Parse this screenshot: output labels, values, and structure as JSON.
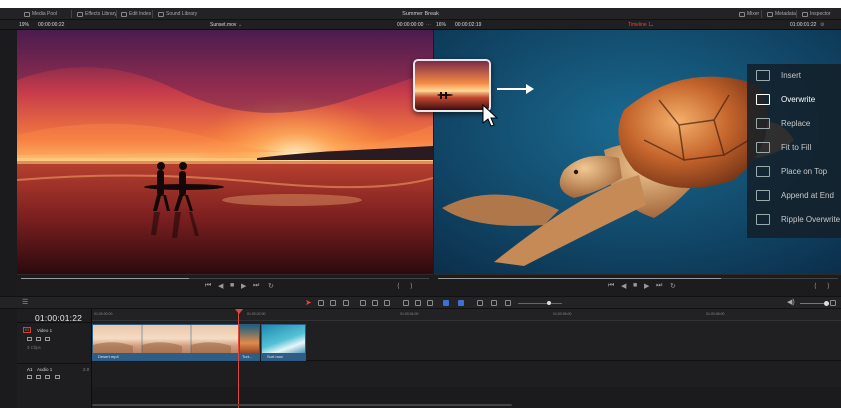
{
  "app": {
    "window_title": "Summer Break",
    "toolbar": {
      "media_pool": "Media Pool",
      "effects_library": "Effects Library",
      "edit_index": "Edit Index",
      "sound_library": "Sound Library",
      "mixer": "Mixer",
      "metadata": "Metadata",
      "inspector": "Inspector"
    }
  },
  "source_viewer": {
    "zoom": "19%",
    "timecode_left": "00:00:00:22",
    "clip_name": "Sunset.mov",
    "timecode_right": "00:00:00:00"
  },
  "timeline_viewer": {
    "zoom": "16%",
    "duration": "00:00:02:19",
    "timeline_name": "Timeline 1",
    "timecode": "01:00:01:22"
  },
  "edit_overlay_menu": {
    "items": [
      {
        "label": "Insert"
      },
      {
        "label": "Overwrite",
        "active": true
      },
      {
        "label": "Replace"
      },
      {
        "label": "Fit to Fill"
      },
      {
        "label": "Place on Top"
      },
      {
        "label": "Append at End"
      },
      {
        "label": "Ripple Overwrite"
      }
    ]
  },
  "timeline": {
    "current_timecode": "01:00:01:22",
    "ruler_ticks": [
      "01:00:00:00",
      "01:00:02:00",
      "01:00:04:00",
      "01:00:06:00",
      "01:00:08:00"
    ],
    "tracks": {
      "video": {
        "id": "V1",
        "name": "Video 1",
        "clip_count": "3 Clips"
      },
      "audio": {
        "id": "A1",
        "name": "Audio 1",
        "channels": "2.0"
      }
    },
    "clips": [
      {
        "label": "Desert.mp4"
      },
      {
        "label": "Turt..."
      },
      {
        "label": "Surf.mov"
      }
    ]
  },
  "colors": {
    "playhead": "#e0463c",
    "clip_bar": "#2e5e86",
    "timeline_label": "#e0463c"
  }
}
